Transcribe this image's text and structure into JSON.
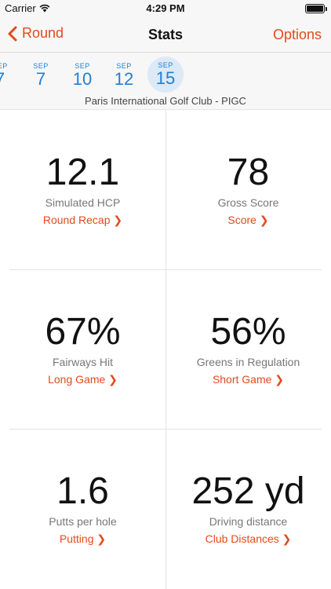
{
  "status_bar": {
    "carrier": "Carrier",
    "time": "4:29 PM"
  },
  "nav": {
    "back_label": "Round",
    "title": "Stats",
    "options_label": "Options"
  },
  "dates": [
    {
      "month": "SEP",
      "day": "7"
    },
    {
      "month": "SEP",
      "day": "7"
    },
    {
      "month": "SEP",
      "day": "10"
    },
    {
      "month": "SEP",
      "day": "12"
    },
    {
      "month": "SEP",
      "day": "15"
    }
  ],
  "selected_date_index": 4,
  "course_name": "Paris International Golf Club - PIGC",
  "stats": [
    {
      "value": "12.1",
      "label": "Simulated HCP",
      "link": "Round Recap ❯"
    },
    {
      "value": "78",
      "label": "Gross Score",
      "link": "Score ❯"
    },
    {
      "value": "67%",
      "label": "Fairways Hit",
      "link": "Long Game ❯"
    },
    {
      "value": "56%",
      "label": "Greens in Regulation",
      "link": "Short Game ❯"
    },
    {
      "value": "1.6",
      "label": "Putts per hole",
      "link": "Putting ❯"
    },
    {
      "value": "252 yd",
      "label": "Driving distance",
      "link": "Club Distances ❯"
    }
  ],
  "colors": {
    "accent": "#e24a1b",
    "date_blue": "#1f7fd6",
    "selected_bg": "#dce9f6"
  }
}
